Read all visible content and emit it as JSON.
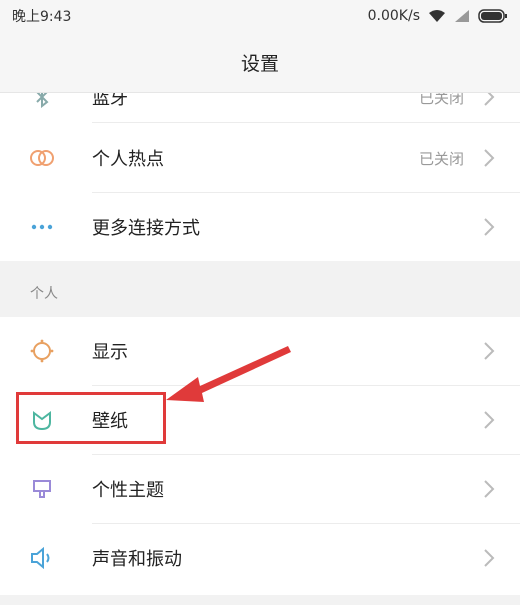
{
  "status": {
    "time": "晚上9:43",
    "speed": "0.00K/s"
  },
  "header": {
    "title": "设置"
  },
  "rows_top": [
    {
      "label": "蓝牙",
      "value": "已关闭",
      "icon": "bluetooth-icon"
    },
    {
      "label": "个人热点",
      "value": "已关闭",
      "icon": "hotspot-icon"
    },
    {
      "label": "更多连接方式",
      "value": "",
      "icon": "more-connections-icon"
    }
  ],
  "section": {
    "title": "个人"
  },
  "rows_personal": [
    {
      "label": "显示",
      "icon": "display-icon"
    },
    {
      "label": "壁纸",
      "icon": "wallpaper-icon"
    },
    {
      "label": "个性主题",
      "icon": "theme-icon"
    },
    {
      "label": "声音和振动",
      "icon": "sound-icon"
    }
  ],
  "colors": {
    "highlight": "#e03a3a",
    "hotspot": "#f0a070",
    "more": "#4aa3d8",
    "display": "#e8a060",
    "wallpaper": "#4db6a0",
    "theme": "#9a8ad8",
    "sound": "#4aa3d8"
  }
}
